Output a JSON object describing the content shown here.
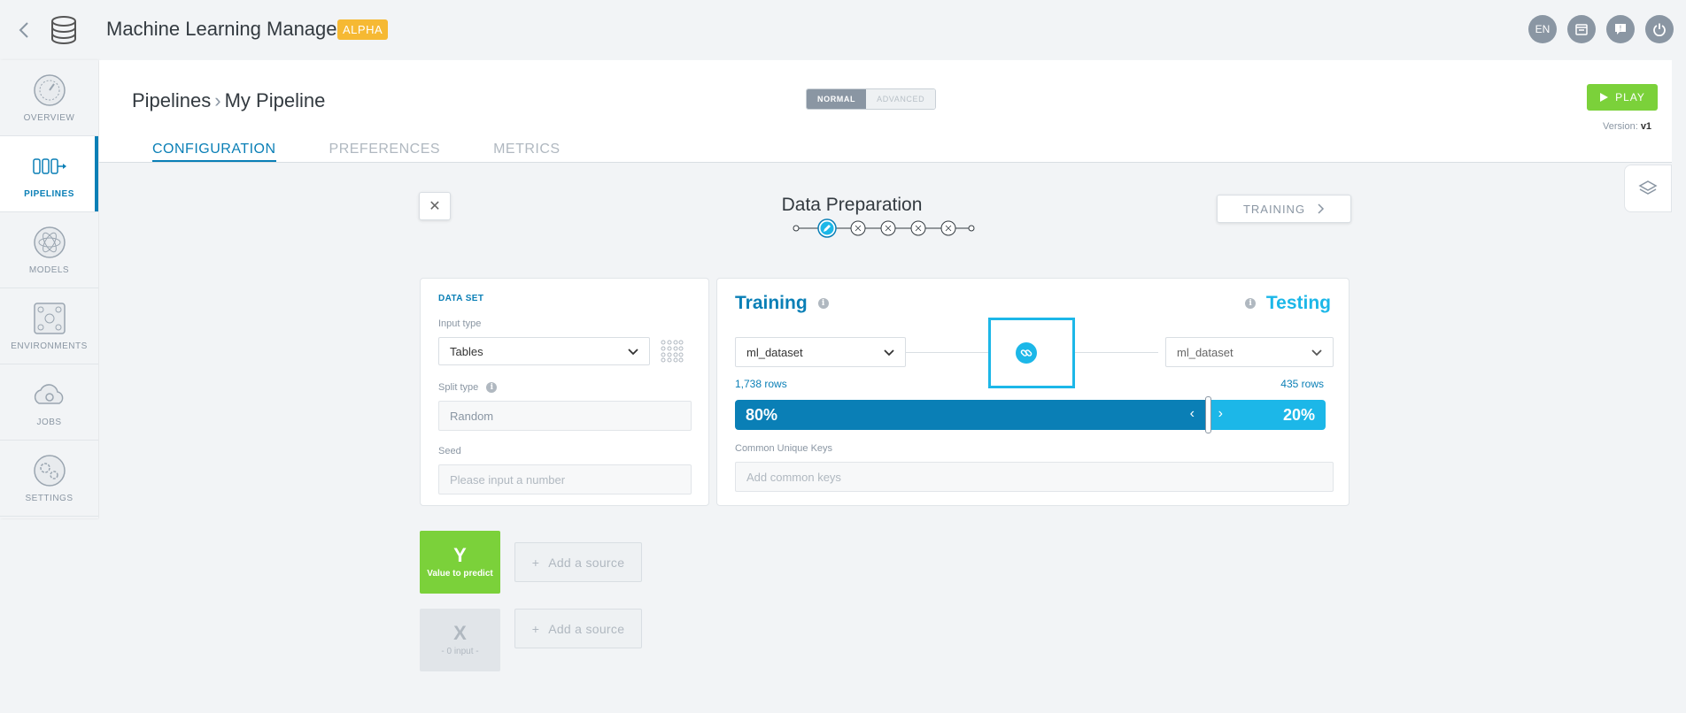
{
  "topbar": {
    "title": "Machine Learning Manager",
    "badge": "ALPHA",
    "lang": "EN",
    "icons": [
      "calendar-icon",
      "feedback-icon",
      "power-icon"
    ]
  },
  "sidebar": {
    "items": [
      {
        "label": "OVERVIEW",
        "icon": "gauge-icon"
      },
      {
        "label": "PIPELINES",
        "icon": "pipeline-icon",
        "active": true
      },
      {
        "label": "MODELS",
        "icon": "atom-icon"
      },
      {
        "label": "ENVIRONMENTS",
        "icon": "network-icon"
      },
      {
        "label": "JOBS",
        "icon": "cloud-gear-icon"
      },
      {
        "label": "SETTINGS",
        "icon": "gears-icon"
      }
    ]
  },
  "header": {
    "breadcrumb_root": "Pipelines",
    "breadcrumb_current": "My Pipeline",
    "mode_normal": "NORMAL",
    "mode_advanced": "ADVANCED",
    "play_label": "PLAY",
    "version_label": "Version:",
    "version_value": "v1",
    "tabs": [
      "CONFIGURATION",
      "PREFERENCES",
      "METRICS"
    ]
  },
  "wizard": {
    "title": "Data Preparation",
    "next_label": "TRAINING",
    "steps_total": 6,
    "current_step": 1
  },
  "dataset": {
    "title": "DATA SET",
    "input_type_label": "Input type",
    "input_type_value": "Tables",
    "split_type_label": "Split type",
    "split_type_value": "Random",
    "seed_label": "Seed",
    "seed_placeholder": "Please input a number"
  },
  "split": {
    "training_title": "Training",
    "testing_title": "Testing",
    "training_dataset": "ml_dataset",
    "testing_dataset": "ml_dataset",
    "training_rows": "1,738 rows",
    "testing_rows": "435 rows",
    "training_pct_label": "80%",
    "testing_pct_label": "20%",
    "training_fraction": 0.8,
    "keys_label": "Common Unique Keys",
    "keys_placeholder": "Add common keys"
  },
  "variables": {
    "y_letter": "Y",
    "y_caption": "Value to predict",
    "x_letter": "X",
    "x_caption": "- 0 input -",
    "add_source_label": "Add a source"
  },
  "colors": {
    "primary": "#0a7fb6",
    "accent": "#1cb7e8",
    "green": "#7bd13a",
    "alpha_badge": "#f6b933"
  }
}
